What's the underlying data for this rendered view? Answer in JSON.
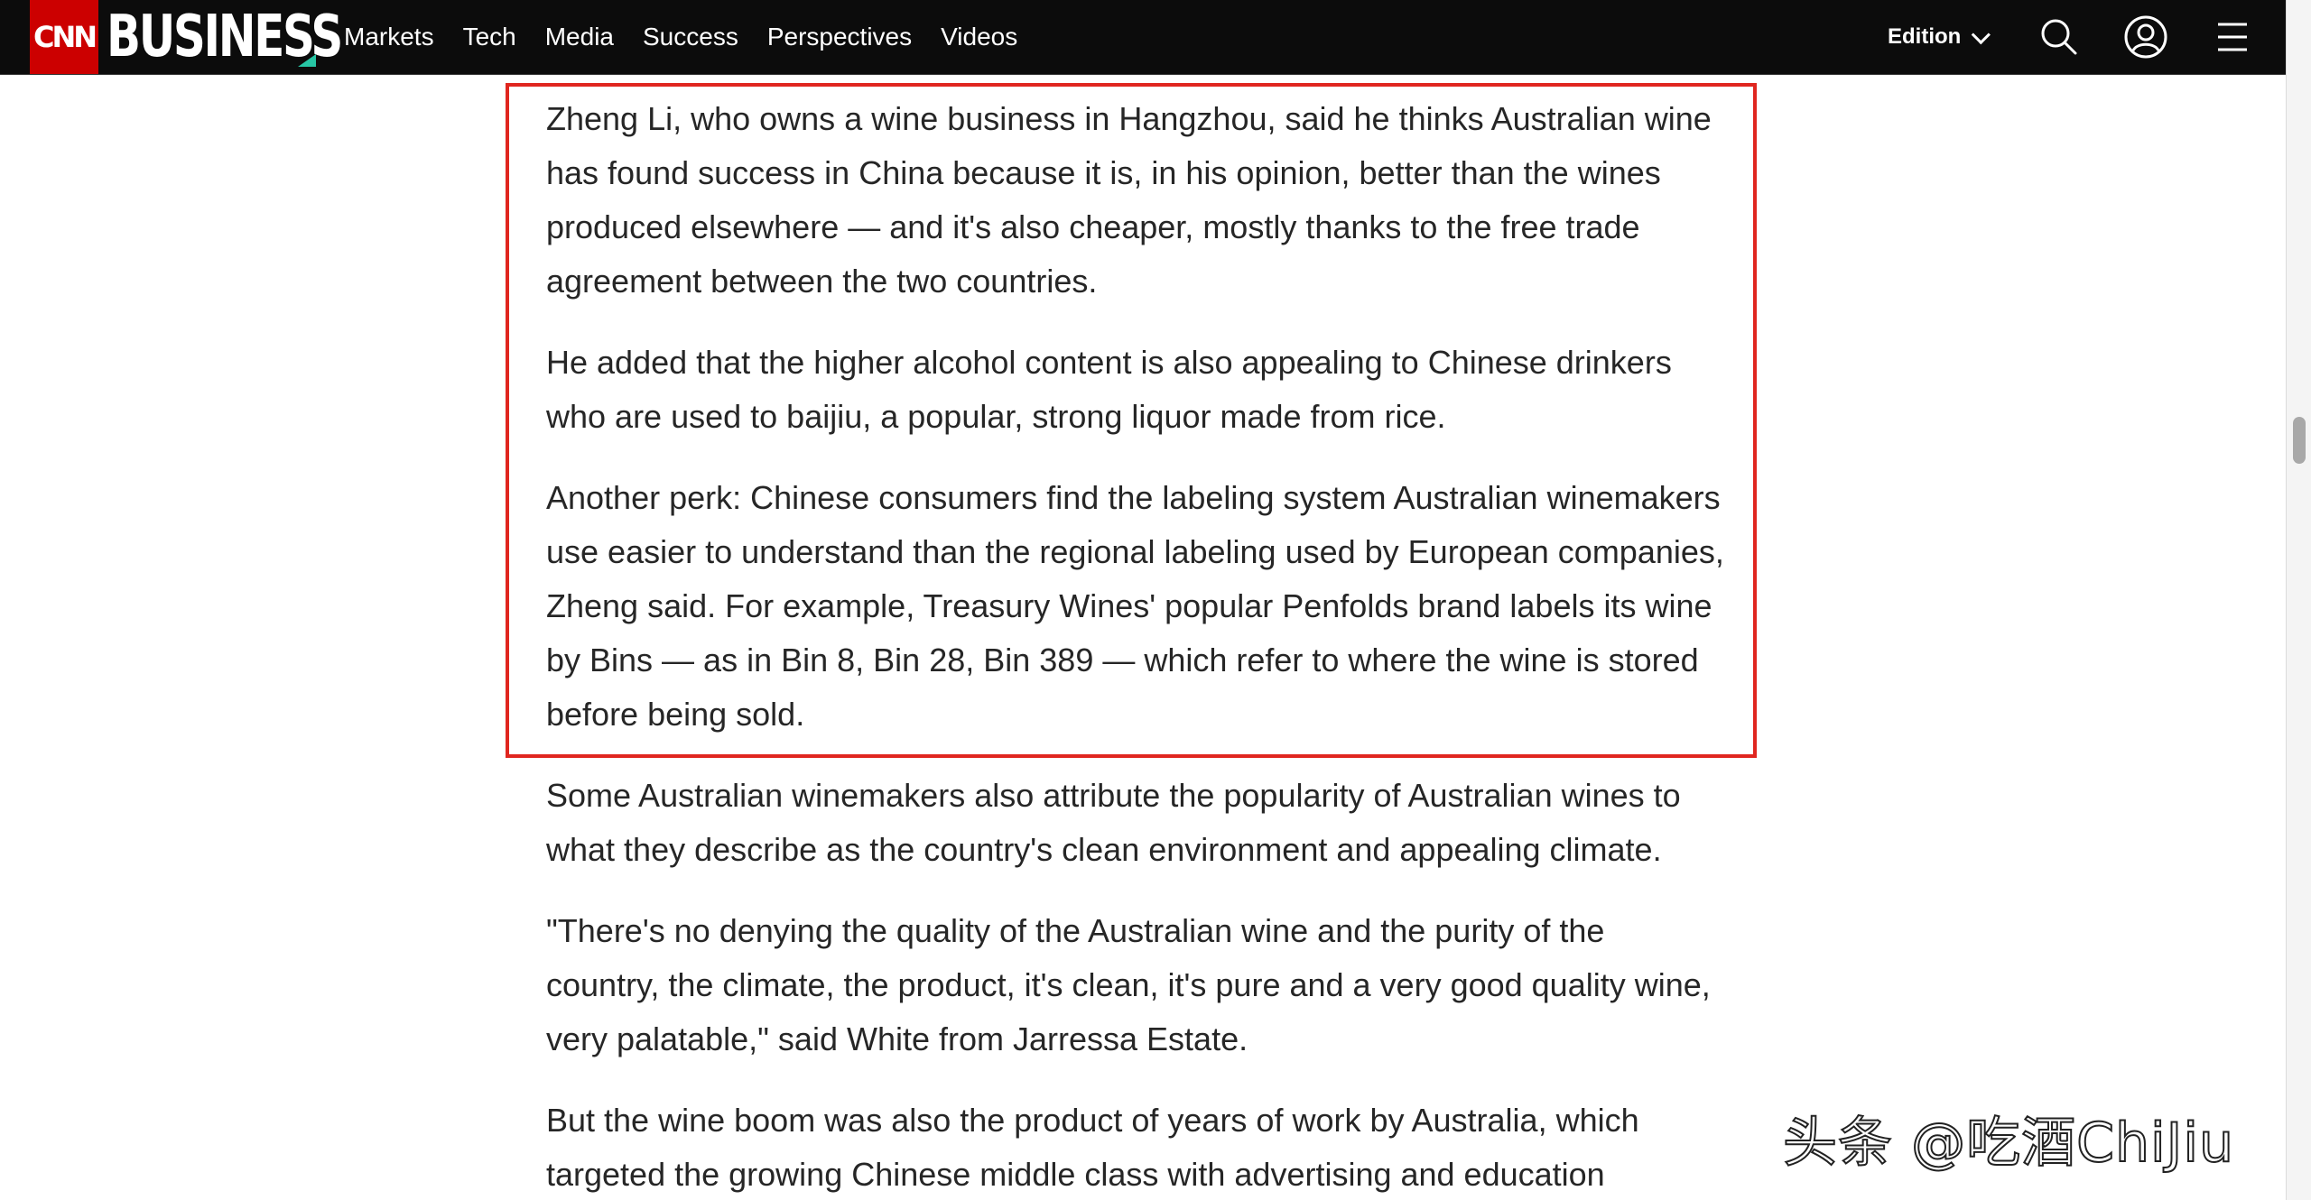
{
  "header": {
    "brand_cnn": "CNN",
    "brand_section": "BUSINESS",
    "nav": [
      "Markets",
      "Tech",
      "Media",
      "Success",
      "Perspectives",
      "Videos"
    ],
    "edition_label": "Edition",
    "icons": [
      "search-icon",
      "user-account-icon",
      "hamburger-menu-icon"
    ],
    "colors": {
      "brand_red": "#cc0000",
      "nav_bg": "#0c0c0c",
      "accent_teal": "#27c6a5"
    }
  },
  "article": {
    "paragraphs": [
      [
        "Zheng Li, who owns a wine business in Hangzhou, said he thinks Australian wine",
        "has found success in China because it is, in his opinion, better than the wines",
        "produced elsewhere — and it's also cheaper, mostly thanks to the free trade",
        "agreement between the two countries."
      ],
      [
        "He added that the higher alcohol content is also appealing to Chinese drinkers",
        "who are used to baijiu, a popular, strong liquor made from rice."
      ],
      [
        "Another perk: Chinese consumers find the labeling system Australian winemakers",
        "use easier to understand than the regional labeling used by European companies,",
        "Zheng said. For example, Treasury Wines' popular Penfolds brand labels its wine",
        "by Bins — as in Bin 8, Bin 28, Bin 389 — which refer to where the wine is stored",
        "before being sold."
      ],
      [
        "Some Australian winemakers also attribute the popularity of Australian wines to",
        "what they describe as the country's clean environment and appealing climate."
      ],
      [
        "\"There's no denying the quality of the Australian wine and the purity of the",
        "country, the climate, the product, it's clean, it's pure and a very good quality wine,",
        "very palatable,\" said White from Jarressa Estate."
      ],
      [
        "But the wine boom was also the product of years of work by Australia, which",
        "targeted the growing Chinese middle class with advertising and education"
      ]
    ],
    "highlight_color": "#e0261f"
  },
  "watermark": "头条 @吃酒ChiJiu"
}
